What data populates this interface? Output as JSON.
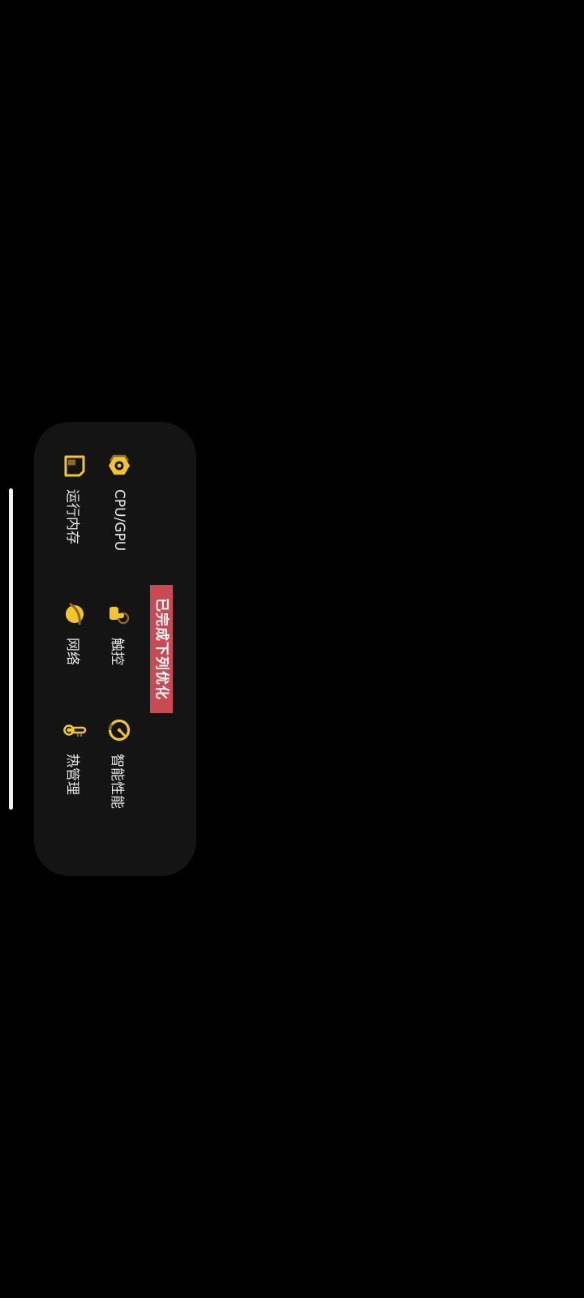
{
  "header": {
    "title": "已完成下列优化"
  },
  "items": [
    {
      "label": "CPU/GPU",
      "icon": "cpu-gpu-icon"
    },
    {
      "label": "触控",
      "icon": "touch-icon"
    },
    {
      "label": "智能性能",
      "icon": "smart-performance-icon"
    },
    {
      "label": "运行内存",
      "icon": "memory-icon"
    },
    {
      "label": "网络",
      "icon": "network-icon"
    },
    {
      "label": "热管理",
      "icon": "thermal-icon"
    }
  ],
  "colors": {
    "background": "#000000",
    "panel": "#141414",
    "badge": "#c94a55",
    "icon_accent": "#f4c430"
  }
}
